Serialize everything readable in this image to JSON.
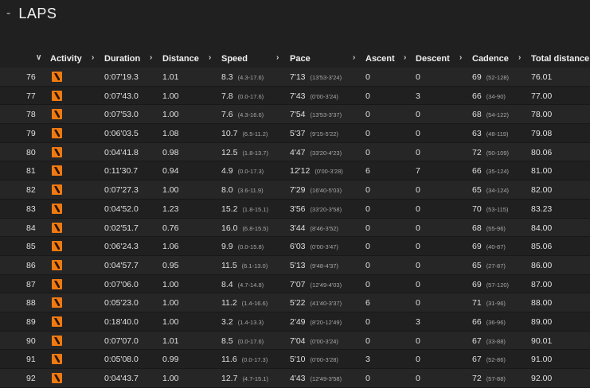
{
  "section": {
    "title": "LAPS",
    "collapse_symbol": "-"
  },
  "columns": [
    "Activity",
    "Duration",
    "Distance",
    "Speed",
    "Pace",
    "Ascent",
    "Descent",
    "Cadence",
    "Total distance"
  ],
  "icons": {
    "sort": "chevron-down-icon",
    "expand": "chevron-right-icon",
    "activity": "running-icon",
    "activity_color": "#f07a12"
  },
  "laps": [
    {
      "n": "76",
      "dur": "0:07'19.3",
      "dist": "1.01",
      "spd": "8.3",
      "spdr": "(4.3-17.6)",
      "pace": "7'13",
      "pacer": "(13'53-3'24)",
      "asc": "0",
      "desc": "0",
      "cad": "69",
      "cadr": "(52-128)",
      "tot": "76.01"
    },
    {
      "n": "77",
      "dur": "0:07'43.0",
      "dist": "1.00",
      "spd": "7.8",
      "spdr": "(0.0-17.6)",
      "pace": "7'43",
      "pacer": "(0'00-3'24)",
      "asc": "0",
      "desc": "3",
      "cad": "66",
      "cadr": "(34-90)",
      "tot": "77.00"
    },
    {
      "n": "78",
      "dur": "0:07'53.0",
      "dist": "1.00",
      "spd": "7.6",
      "spdr": "(4.3-16.6)",
      "pace": "7'54",
      "pacer": "(13'53-3'37)",
      "asc": "0",
      "desc": "0",
      "cad": "68",
      "cadr": "(54-122)",
      "tot": "78.00"
    },
    {
      "n": "79",
      "dur": "0:06'03.5",
      "dist": "1.08",
      "spd": "10.7",
      "spdr": "(6.5-11.2)",
      "pace": "5'37",
      "pacer": "(9'15-5'22)",
      "asc": "0",
      "desc": "0",
      "cad": "63",
      "cadr": "(48-119)",
      "tot": "79.08"
    },
    {
      "n": "80",
      "dur": "0:04'41.8",
      "dist": "0.98",
      "spd": "12.5",
      "spdr": "(1.8-13.7)",
      "pace": "4'47",
      "pacer": "(33'20-4'23)",
      "asc": "0",
      "desc": "0",
      "cad": "72",
      "cadr": "(50-109)",
      "tot": "80.06"
    },
    {
      "n": "81",
      "dur": "0:11'30.7",
      "dist": "0.94",
      "spd": "4.9",
      "spdr": "(0.0-17.3)",
      "pace": "12'12",
      "pacer": "(0'00-3'28)",
      "asc": "6",
      "desc": "7",
      "cad": "66",
      "cadr": "(35-124)",
      "tot": "81.00"
    },
    {
      "n": "82",
      "dur": "0:07'27.3",
      "dist": "1.00",
      "spd": "8.0",
      "spdr": "(3.6-11.9)",
      "pace": "7'29",
      "pacer": "(16'40-5'03)",
      "asc": "0",
      "desc": "0",
      "cad": "65",
      "cadr": "(34-124)",
      "tot": "82.00"
    },
    {
      "n": "83",
      "dur": "0:04'52.0",
      "dist": "1.23",
      "spd": "15.2",
      "spdr": "(1.8-15.1)",
      "pace": "3'56",
      "pacer": "(33'20-3'58)",
      "asc": "0",
      "desc": "0",
      "cad": "70",
      "cadr": "(53-115)",
      "tot": "83.23"
    },
    {
      "n": "84",
      "dur": "0:02'51.7",
      "dist": "0.76",
      "spd": "16.0",
      "spdr": "(6.8-15.5)",
      "pace": "3'44",
      "pacer": "(8'46-3'52)",
      "asc": "0",
      "desc": "0",
      "cad": "68",
      "cadr": "(55-96)",
      "tot": "84.00"
    },
    {
      "n": "85",
      "dur": "0:06'24.3",
      "dist": "1.06",
      "spd": "9.9",
      "spdr": "(0.0-15.8)",
      "pace": "6'03",
      "pacer": "(0'00-3'47)",
      "asc": "0",
      "desc": "0",
      "cad": "69",
      "cadr": "(40-87)",
      "tot": "85.06"
    },
    {
      "n": "86",
      "dur": "0:04'57.7",
      "dist": "0.95",
      "spd": "11.5",
      "spdr": "(6.1-13.0)",
      "pace": "5'13",
      "pacer": "(9'48-4'37)",
      "asc": "0",
      "desc": "0",
      "cad": "65",
      "cadr": "(27-87)",
      "tot": "86.00"
    },
    {
      "n": "87",
      "dur": "0:07'06.0",
      "dist": "1.00",
      "spd": "8.4",
      "spdr": "(4.7-14.8)",
      "pace": "7'07",
      "pacer": "(12'49-4'03)",
      "asc": "0",
      "desc": "0",
      "cad": "69",
      "cadr": "(57-120)",
      "tot": "87.00"
    },
    {
      "n": "88",
      "dur": "0:05'23.0",
      "dist": "1.00",
      "spd": "11.2",
      "spdr": "(1.4-16.6)",
      "pace": "5'22",
      "pacer": "(41'40-3'37)",
      "asc": "6",
      "desc": "0",
      "cad": "71",
      "cadr": "(31-96)",
      "tot": "88.00"
    },
    {
      "n": "89",
      "dur": "0:18'40.0",
      "dist": "1.00",
      "spd": "3.2",
      "spdr": "(1.4-13.3)",
      "pace": "2'49",
      "pacer": "(8'20-12'49)",
      "asc": "0",
      "desc": "3",
      "cad": "66",
      "cadr": "(36-96)",
      "tot": "89.00"
    },
    {
      "n": "90",
      "dur": "0:07'07.0",
      "dist": "1.01",
      "spd": "8.5",
      "spdr": "(0.0-17.6)",
      "pace": "7'04",
      "pacer": "(0'00-3'24)",
      "asc": "0",
      "desc": "0",
      "cad": "67",
      "cadr": "(33-88)",
      "tot": "90.01"
    },
    {
      "n": "91",
      "dur": "0:05'08.0",
      "dist": "0.99",
      "spd": "11.6",
      "spdr": "(0.0-17.3)",
      "pace": "5'10",
      "pacer": "(0'00-3'28)",
      "asc": "3",
      "desc": "0",
      "cad": "67",
      "cadr": "(52-86)",
      "tot": "91.00"
    },
    {
      "n": "92",
      "dur": "0:04'43.7",
      "dist": "1.00",
      "spd": "12.7",
      "spdr": "(4.7-15.1)",
      "pace": "4'43",
      "pacer": "(12'49-3'58)",
      "asc": "0",
      "desc": "0",
      "cad": "72",
      "cadr": "(57-88)",
      "tot": "92.00"
    }
  ]
}
